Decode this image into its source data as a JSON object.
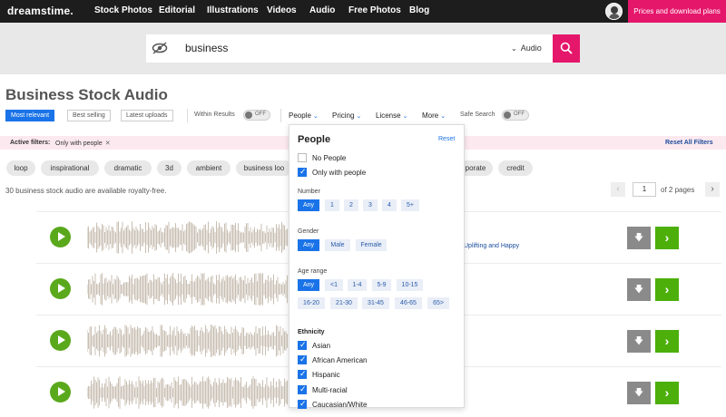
{
  "header": {
    "logo": "dreamstime.",
    "nav": [
      "Stock Photos",
      "Editorial",
      "Illustrations",
      "Videos",
      "Audio",
      "Free Photos",
      "Blog"
    ],
    "plans_button": "Prices and download plans"
  },
  "search": {
    "query": "business",
    "media_type": "Audio"
  },
  "page": {
    "title": "Business Stock Audio"
  },
  "toolbar": {
    "sort_options": [
      "Most relevant",
      "Best selling",
      "Latest uploads"
    ],
    "within_results_label": "Within Results",
    "within_results_state": "OFF",
    "filters": [
      "People",
      "Pricing",
      "License",
      "More"
    ],
    "safe_search_label": "Safe Search",
    "safe_search_state": "OFF"
  },
  "active_filters": {
    "label": "Active filters:",
    "chips": [
      "Only with people"
    ],
    "reset_all": "Reset All Filters"
  },
  "tags": [
    "loop",
    "inspirational",
    "dramatic",
    "3d",
    "ambient",
    "business loo",
    "porate",
    "credit"
  ],
  "results": {
    "count_text": "30 business stock audio are available royalty-free.",
    "current_page": "1",
    "of_pages": "of 2 pages"
  },
  "tracks": [
    {
      "title": "Uplifting and Happy"
    },
    {
      "title": ""
    },
    {
      "title": ""
    },
    {
      "title": ""
    }
  ],
  "people_panel": {
    "title": "People",
    "reset": "Reset",
    "presence": [
      {
        "label": "No People",
        "checked": false
      },
      {
        "label": "Only with people",
        "checked": true
      }
    ],
    "number_label": "Number",
    "number_options": [
      "Any",
      "1",
      "2",
      "3",
      "4",
      "5+"
    ],
    "gender_label": "Gender",
    "gender_options": [
      "Any",
      "Male",
      "Female"
    ],
    "age_label": "Age range",
    "age_options_row1": [
      "Any",
      "<1",
      "1-4",
      "5-9",
      "10-15"
    ],
    "age_options_row2": [
      "16-20",
      "21-30",
      "31-45",
      "46-65",
      "65>"
    ],
    "ethnicity_label": "Ethnicity",
    "ethnicity_options": [
      {
        "label": "Asian",
        "checked": true
      },
      {
        "label": "African American",
        "checked": true
      },
      {
        "label": "Hispanic",
        "checked": true
      },
      {
        "label": "Multi-racial",
        "checked": true
      },
      {
        "label": "Caucasian/White",
        "checked": true
      }
    ]
  },
  "colors": {
    "accent_pink": "#e5176b",
    "primary_blue": "#1a73e8",
    "play_green": "#5aa81c",
    "download_green": "#4caf0a"
  },
  "icons": {
    "eye": "eye-icon",
    "search": "search-icon",
    "play": "play-icon",
    "download": "download-icon",
    "go": "chevron-right-icon"
  }
}
